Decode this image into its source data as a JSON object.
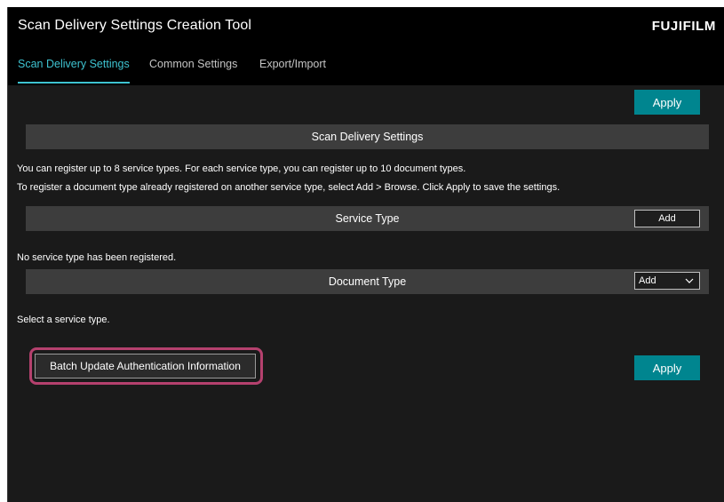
{
  "app": {
    "title": "Scan Delivery Settings Creation Tool",
    "brand": "FUJIFILM"
  },
  "tabs": [
    {
      "label": "Scan Delivery Settings",
      "active": true
    },
    {
      "label": "Common Settings",
      "active": false
    },
    {
      "label": "Export/Import",
      "active": false
    }
  ],
  "toolbar": {
    "apply_label": "Apply"
  },
  "scan_delivery": {
    "header": "Scan Delivery Settings",
    "description_line1": "You can register up to 8 service types. For each service type, you can register up to 10 document types.",
    "description_line2": "To register a document type already registered on another service type, select Add > Browse. Click Apply to save the settings."
  },
  "service_type": {
    "header": "Service Type",
    "add_label": "Add",
    "empty_message": "No service type has been registered."
  },
  "document_type": {
    "header": "Document Type",
    "add_select_value": "Add",
    "empty_message": "Select a service type."
  },
  "footer": {
    "batch_update_label": "Batch Update Authentication Information",
    "apply_label": "Apply"
  },
  "colors": {
    "accent": "#3ec3d1",
    "apply_button": "#00858f",
    "highlight": "#b5416e",
    "background": "#1a1a1a",
    "section_header": "#3d3d3d"
  }
}
